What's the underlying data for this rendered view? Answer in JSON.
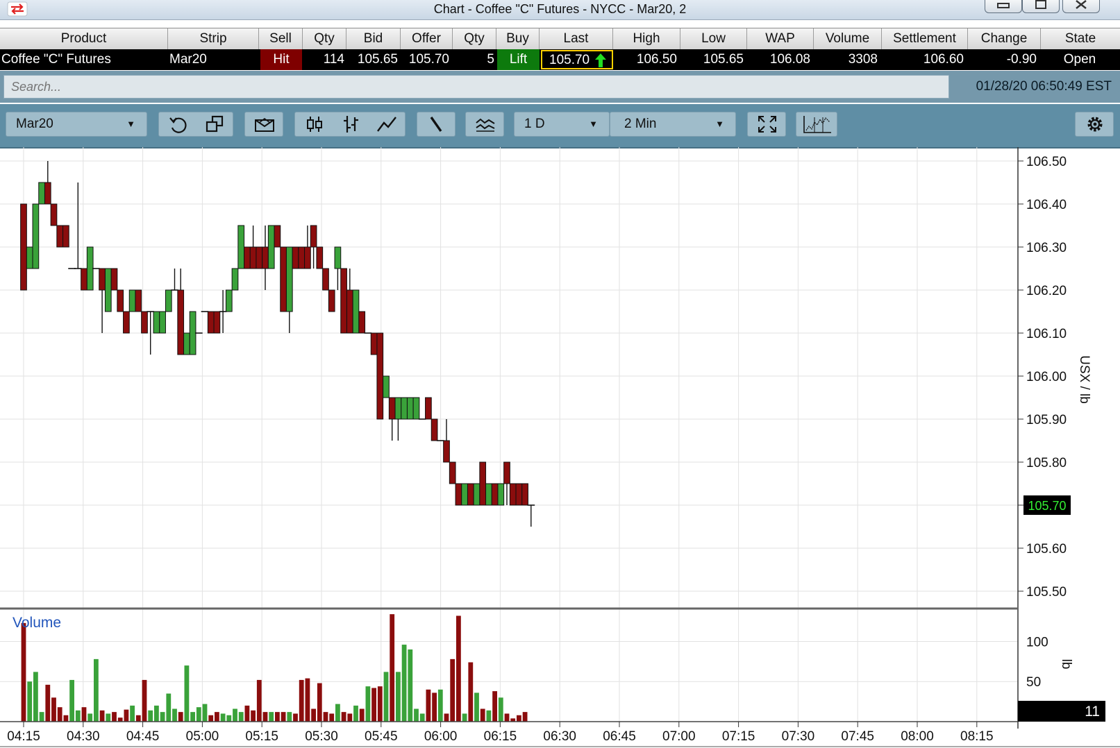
{
  "window": {
    "title": "Chart - Coffee \"C\" Futures - NYCC - Mar20, 2"
  },
  "quote": {
    "headers": [
      "Product",
      "Strip",
      "Sell",
      "Qty",
      "Bid",
      "Offer",
      "Qty",
      "Buy",
      "Last",
      "High",
      "Low",
      "WAP",
      "Volume",
      "Settlement",
      "Change",
      "State"
    ],
    "row": {
      "product": "Coffee \"C\" Futures",
      "strip": "Mar20",
      "sell": "Hit",
      "bid_qty": "114",
      "bid": "105.65",
      "offer": "105.70",
      "offer_qty": "5",
      "buy": "Lift",
      "last": "105.70",
      "high": "106.50",
      "low": "105.65",
      "wap": "106.08",
      "volume": "3308",
      "settlement": "106.60",
      "change": "-0.90",
      "state": "Open"
    },
    "colors": {
      "sell_bg": "#7f0000",
      "buy_bg": "#0d7a0d",
      "last_border": "#ffd200",
      "up_arrow": "#22dd22"
    }
  },
  "search": {
    "placeholder": "Search...",
    "datetime": "01/28/20 06:50:49 EST"
  },
  "toolbar": {
    "contract_select": "Mar20",
    "range_select": "1 D",
    "interval_select": "2 Min",
    "icons": [
      "refresh-icon",
      "copy-window-icon",
      "envelope-icon",
      "candlestick-icon",
      "ohlc-bars-icon",
      "line-chart-icon",
      "draw-line-icon",
      "indicator-icon",
      "expand-icon",
      "chart-settings-icon",
      "gear-icon"
    ]
  },
  "chart_data": [
    {
      "type": "candlestick",
      "ylabel": "USX / lb",
      "ylim": [
        105.45,
        106.55
      ],
      "y_ticks": [
        "106.50",
        "106.40",
        "106.30",
        "106.20",
        "106.10",
        "106.00",
        "105.90",
        "105.80",
        "105.70",
        "105.60",
        "105.50"
      ],
      "x_ticks": [
        "04:15",
        "04:30",
        "04:45",
        "05:00",
        "05:15",
        "05:30",
        "05:45",
        "06:00",
        "06:15",
        "06:30",
        "06:45",
        "07:00",
        "07:15",
        "07:30",
        "07:45",
        "08:00",
        "08:15"
      ],
      "last_price": "105.70",
      "colors": {
        "up": "#3aa23a",
        "down": "#8b0d0d",
        "last_label_text": "#33ee33",
        "last_label_bg": "#000000"
      },
      "candles": [
        [
          106.4,
          106.4,
          106.2,
          106.2
        ],
        [
          106.25,
          106.3,
          106.25,
          106.3
        ],
        [
          106.25,
          106.4,
          106.25,
          106.4
        ],
        [
          106.4,
          106.45,
          106.4,
          106.45
        ],
        [
          106.45,
          106.5,
          106.4,
          106.4
        ],
        [
          106.4,
          106.4,
          106.35,
          106.35
        ],
        [
          106.35,
          106.35,
          106.3,
          106.3
        ],
        [
          106.35,
          106.35,
          106.3,
          106.3
        ],
        [
          106.25,
          106.25,
          106.25,
          106.25
        ],
        [
          106.25,
          106.45,
          106.25,
          106.25
        ],
        [
          106.25,
          106.25,
          106.2,
          106.2
        ],
        [
          106.2,
          106.3,
          106.2,
          106.3
        ],
        [
          106.25,
          106.25,
          106.25,
          106.25
        ],
        [
          106.25,
          106.25,
          106.1,
          106.2
        ],
        [
          106.15,
          106.25,
          106.15,
          106.25
        ],
        [
          106.25,
          106.25,
          106.2,
          106.2
        ],
        [
          106.2,
          106.2,
          106.15,
          106.15
        ],
        [
          106.15,
          106.15,
          106.1,
          106.1
        ],
        [
          106.15,
          106.2,
          106.15,
          106.2
        ],
        [
          106.2,
          106.2,
          106.15,
          106.15
        ],
        [
          106.15,
          106.15,
          106.1,
          106.1
        ],
        [
          106.15,
          106.15,
          106.05,
          106.15
        ],
        [
          106.1,
          106.15,
          106.1,
          106.15
        ],
        [
          106.1,
          106.15,
          106.1,
          106.15
        ],
        [
          106.15,
          106.2,
          106.15,
          106.2
        ],
        [
          106.2,
          106.25,
          106.2,
          106.2
        ],
        [
          106.2,
          106.25,
          106.05,
          106.05
        ],
        [
          106.05,
          106.1,
          106.05,
          106.1
        ],
        [
          106.05,
          106.15,
          106.05,
          106.15
        ],
        [
          106.1,
          106.1,
          106.1,
          106.1
        ],
        [
          106.15,
          106.15,
          106.15,
          106.15
        ],
        [
          106.15,
          106.15,
          106.1,
          106.1
        ],
        [
          106.15,
          106.15,
          106.1,
          106.1
        ],
        [
          106.15,
          106.2,
          106.1,
          106.15
        ],
        [
          106.15,
          106.2,
          106.15,
          106.2
        ],
        [
          106.2,
          106.25,
          106.2,
          106.25
        ],
        [
          106.25,
          106.35,
          106.25,
          106.35
        ],
        [
          106.3,
          106.3,
          106.25,
          106.25
        ],
        [
          106.3,
          106.35,
          106.25,
          106.25
        ],
        [
          106.3,
          106.3,
          106.25,
          106.25
        ],
        [
          106.3,
          106.35,
          106.2,
          106.25
        ],
        [
          106.25,
          106.35,
          106.25,
          106.35
        ],
        [
          106.35,
          106.35,
          106.3,
          106.3
        ],
        [
          106.3,
          106.3,
          106.15,
          106.15
        ],
        [
          106.15,
          106.3,
          106.1,
          106.3
        ],
        [
          106.3,
          106.3,
          106.25,
          106.25
        ],
        [
          106.3,
          106.3,
          106.25,
          106.25
        ],
        [
          106.3,
          106.35,
          106.25,
          106.25
        ],
        [
          106.35,
          106.35,
          106.25,
          106.3
        ],
        [
          106.3,
          106.3,
          106.25,
          106.25
        ],
        [
          106.25,
          106.25,
          106.2,
          106.2
        ],
        [
          106.2,
          106.2,
          106.15,
          106.15
        ],
        [
          106.25,
          106.3,
          106.2,
          106.3
        ],
        [
          106.25,
          106.25,
          106.1,
          106.1
        ],
        [
          106.2,
          106.25,
          106.1,
          106.1
        ],
        [
          106.1,
          106.2,
          106.1,
          106.2
        ],
        [
          106.15,
          106.15,
          106.1,
          106.1
        ],
        [
          106.1,
          106.1,
          106.1,
          106.1
        ],
        [
          106.1,
          106.1,
          106.05,
          106.05
        ],
        [
          106.1,
          106.1,
          105.9,
          105.9
        ],
        [
          105.95,
          106.0,
          105.95,
          106.0
        ],
        [
          105.95,
          105.95,
          105.85,
          105.9
        ],
        [
          105.9,
          105.95,
          105.85,
          105.95
        ],
        [
          105.9,
          105.95,
          105.9,
          105.95
        ],
        [
          105.9,
          105.95,
          105.9,
          105.95
        ],
        [
          105.9,
          105.95,
          105.9,
          105.95
        ],
        [
          105.9,
          105.9,
          105.9,
          105.9
        ],
        [
          105.95,
          105.95,
          105.9,
          105.9
        ],
        [
          105.9,
          105.9,
          105.85,
          105.85
        ],
        [
          105.85,
          105.85,
          105.85,
          105.85
        ],
        [
          105.85,
          105.9,
          105.8,
          105.8
        ],
        [
          105.8,
          105.8,
          105.75,
          105.75
        ],
        [
          105.75,
          105.75,
          105.7,
          105.7
        ],
        [
          105.7,
          105.75,
          105.7,
          105.75
        ],
        [
          105.75,
          105.75,
          105.7,
          105.7
        ],
        [
          105.7,
          105.75,
          105.7,
          105.75
        ],
        [
          105.8,
          105.8,
          105.7,
          105.7
        ],
        [
          105.7,
          105.75,
          105.7,
          105.75
        ],
        [
          105.75,
          105.75,
          105.7,
          105.7
        ],
        [
          105.7,
          105.75,
          105.7,
          105.75
        ],
        [
          105.8,
          105.8,
          105.7,
          105.75
        ],
        [
          105.75,
          105.75,
          105.7,
          105.7
        ],
        [
          105.75,
          105.75,
          105.7,
          105.7
        ],
        [
          105.75,
          105.75,
          105.7,
          105.7
        ],
        [
          105.7,
          105.7,
          105.65,
          105.7
        ]
      ]
    },
    {
      "type": "bar",
      "title": "Volume",
      "ylabel": "lb",
      "ylim": [
        0,
        135
      ],
      "y_ticks": [
        "100",
        "50"
      ],
      "current_value": "11",
      "values": [
        123,
        50,
        62,
        12,
        46,
        30,
        18,
        8,
        52,
        14,
        18,
        10,
        78,
        14,
        10,
        12,
        5,
        15,
        20,
        8,
        52,
        14,
        20,
        12,
        35,
        16,
        12,
        70,
        12,
        18,
        22,
        8,
        12,
        10,
        8,
        16,
        12,
        20,
        14,
        52,
        12,
        12,
        12,
        12,
        12,
        10,
        52,
        54,
        16,
        48,
        12,
        10,
        22,
        12,
        10,
        20,
        16,
        44,
        42,
        44,
        62,
        134,
        62,
        96,
        90,
        16,
        10,
        40,
        36,
        40,
        10,
        78,
        132,
        10,
        74,
        36,
        16,
        14,
        38,
        30,
        10,
        4,
        8,
        12
      ]
    }
  ]
}
